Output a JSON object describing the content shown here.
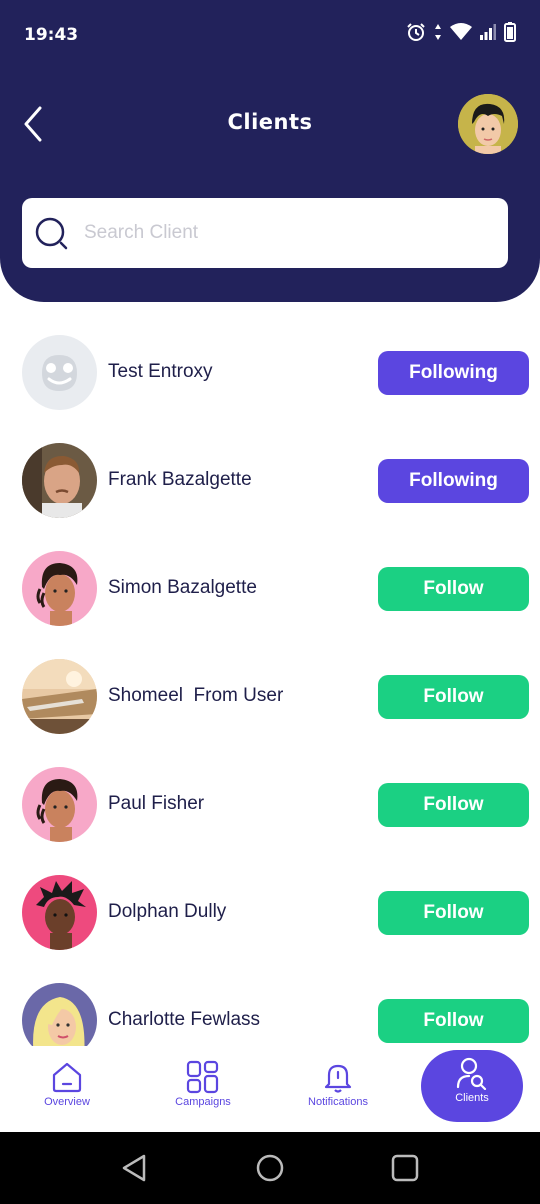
{
  "status_bar": {
    "time": "19:43"
  },
  "header": {
    "title": "Clients"
  },
  "search": {
    "placeholder": "Search Client",
    "value": ""
  },
  "clients": [
    {
      "name": "Test Entroxy",
      "action": "Following"
    },
    {
      "name": "Frank Bazalgette",
      "action": "Following"
    },
    {
      "name": "Simon Bazalgette",
      "action": "Follow"
    },
    {
      "name": "Shomeel  From User",
      "action": "Follow"
    },
    {
      "name": "Paul Fisher",
      "action": "Follow"
    },
    {
      "name": "Dolphan Dully",
      "action": "Follow"
    },
    {
      "name": "Charlotte Fewlass",
      "action": "Follow"
    }
  ],
  "bottom_nav": [
    {
      "label": "Overview",
      "icon": "home-icon"
    },
    {
      "label": "Campaigns",
      "icon": "grid-icon"
    },
    {
      "label": "Notifications",
      "icon": "bell-icon"
    },
    {
      "label": "Clients",
      "icon": "user-search-icon",
      "active": true
    }
  ],
  "colors": {
    "header": "#22225b",
    "following": "#5b46e0",
    "follow": "#1bd083",
    "text": "#1f1f4a"
  }
}
